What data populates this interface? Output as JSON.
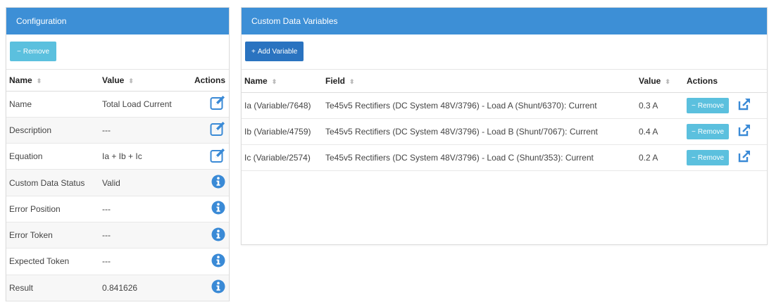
{
  "configuration": {
    "title": "Configuration",
    "remove_label": "Remove",
    "headers": {
      "name": "Name",
      "value": "Value",
      "actions": "Actions"
    },
    "rows": [
      {
        "name": "Name",
        "value": "Total Load Current",
        "action": "edit-icon"
      },
      {
        "name": "Description",
        "value": "---",
        "action": "edit-icon"
      },
      {
        "name": "Equation",
        "value": "Ia + Ib + Ic",
        "action": "edit-icon"
      },
      {
        "name": "Custom Data Status",
        "value": "Valid",
        "action": "info-icon"
      },
      {
        "name": "Error Position",
        "value": "---",
        "action": "info-icon"
      },
      {
        "name": "Error Token",
        "value": "---",
        "action": "info-icon"
      },
      {
        "name": "Expected Token",
        "value": "---",
        "action": "info-icon"
      },
      {
        "name": "Result",
        "value": "0.841626",
        "action": "info-icon"
      }
    ]
  },
  "custom_vars": {
    "title": "Custom Data Variables",
    "add_label": "Add Variable",
    "headers": {
      "name": "Name",
      "field": "Field",
      "value": "Value",
      "actions": "Actions"
    },
    "remove_label": "Remove",
    "rows": [
      {
        "name": "Ia (Variable/7648)",
        "field": "Te45v5 Rectifiers (DC System 48V/3796) - Load A (Shunt/6370): Current",
        "value": "0.3 A"
      },
      {
        "name": "Ib (Variable/4759)",
        "field": "Te45v5 Rectifiers (DC System 48V/3796) - Load B (Shunt/7067): Current",
        "value": "0.4 A"
      },
      {
        "name": "Ic (Variable/2574)",
        "field": "Te45v5 Rectifiers (DC System 48V/3796) - Load C (Shunt/353): Current",
        "value": "0.2 A"
      }
    ]
  },
  "colors": {
    "header_blue": "#3d8fd6",
    "button_info": "#5bc0de",
    "button_primary": "#2a73c0",
    "icon_blue": "#3a8ad6"
  }
}
